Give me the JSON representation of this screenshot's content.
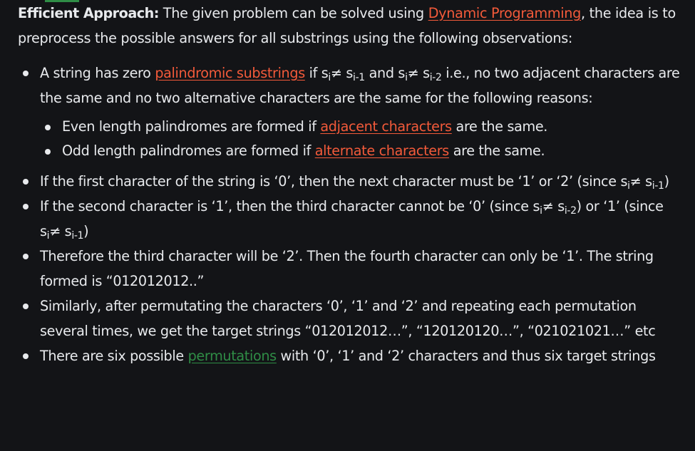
{
  "intro": {
    "bold": "Efficient Approach:",
    "text_before_link": " The given problem can be solved using ",
    "link_dp": "Dynamic Programming",
    "text_after_link": ", the idea is to preprocess the possible answers for all substrings using the following observations:"
  },
  "b1": {
    "a": "A string has zero ",
    "link": "palindromic substrings",
    "b": " if s",
    "sub1": "i",
    "c": "≠ s",
    "sub2": "i-1",
    "d": " and s",
    "sub3": "i",
    "e": "≠ s",
    "sub4": "i-2",
    "f": " i.e., no two adjacent characters are the same and no two alternative characters are the same for the following reasons:"
  },
  "sub1": {
    "a": "Even length palindromes are formed if ",
    "link": "adjacent characters",
    "b": " are the same."
  },
  "sub2": {
    "a": "Odd length palindromes are formed if ",
    "link": "alternate characters",
    "b": " are the same."
  },
  "b2": {
    "a": "If the first character of the string is ‘0’, then the next character must be ‘1’ or ‘2’ (since s",
    "sub1": "i",
    "b": "≠ s",
    "sub2": "i-1",
    "c": ")"
  },
  "b3": {
    "a": "If the second character is ‘1’, then the third character cannot be ‘0’ (since s",
    "sub1": "i",
    "b": "≠ s",
    "sub2": "i-2",
    "c": ") or ‘1’ (since s",
    "sub3": "i",
    "d": "≠ s",
    "sub4": "i-1",
    "e": ")"
  },
  "b4": {
    "text": "Therefore the third character will be ‘2’. Then the fourth character can only be ‘1’. The string formed is “012012012..”"
  },
  "b5": {
    "text": "Similarly, after permutating the characters ‘0’, ‘1’ and ‘2’ and repeating each permutation several times, we get the target strings “012012012…”, “120120120…”, “021021021…” etc"
  },
  "b6": {
    "a": "There are six possible ",
    "link": "permutations",
    "b": " with ‘0’, ‘1’ and ‘2’ characters and thus six target strings"
  },
  "colors": {
    "background": "#131417",
    "text": "#e8eaed",
    "link_red": "#f35a3a",
    "link_green": "#2f8d46"
  }
}
